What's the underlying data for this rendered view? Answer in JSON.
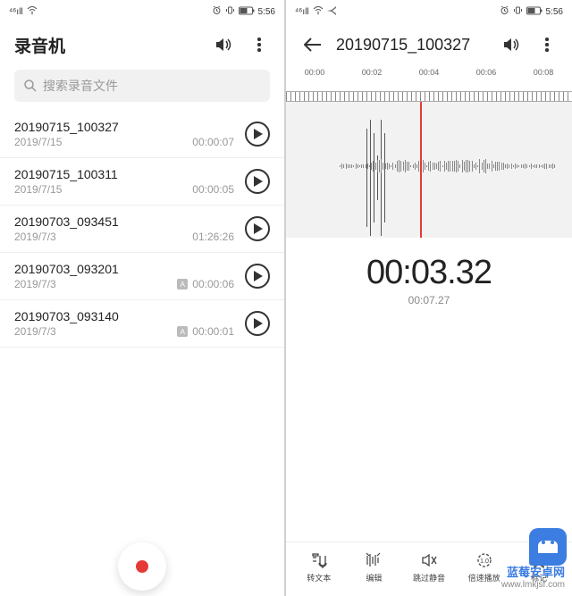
{
  "status": {
    "network": "⁴⁶ıll",
    "wifi": "≋",
    "alarm": "⏰",
    "vibrate": "📳",
    "battery": "▮",
    "time": "5:56"
  },
  "left": {
    "title": "录音机",
    "search_placeholder": "搜索录音文件",
    "recordings": [
      {
        "name": "20190715_100327",
        "date": "2019/7/15",
        "duration": "00:00:07",
        "badge": ""
      },
      {
        "name": "20190715_100311",
        "date": "2019/7/15",
        "duration": "00:00:05",
        "badge": ""
      },
      {
        "name": "20190703_093451",
        "date": "2019/7/3",
        "duration": "01:26:26",
        "badge": ""
      },
      {
        "name": "20190703_093201",
        "date": "2019/7/3",
        "duration": "00:00:06",
        "badge": "A"
      },
      {
        "name": "20190703_093140",
        "date": "2019/7/3",
        "duration": "00:00:01",
        "badge": "A"
      }
    ]
  },
  "right": {
    "title": "20190715_100327",
    "ticks": [
      "00:00",
      "00:02",
      "00:04",
      "00:06",
      "00:08"
    ],
    "current_time": "00:03.32",
    "total_time": "00:07.27",
    "tools": [
      {
        "label": "转文本",
        "icon": "transcribe-icon"
      },
      {
        "label": "编辑",
        "icon": "edit-icon"
      },
      {
        "label": "跳过静音",
        "icon": "skip-silence-icon"
      },
      {
        "label": "倍速播放",
        "icon": "speed-icon"
      },
      {
        "label": "标记",
        "icon": "bookmark-icon"
      }
    ]
  },
  "watermark": {
    "line1": "蓝莓安卓网",
    "line2": "www.lmkjsf.com"
  }
}
